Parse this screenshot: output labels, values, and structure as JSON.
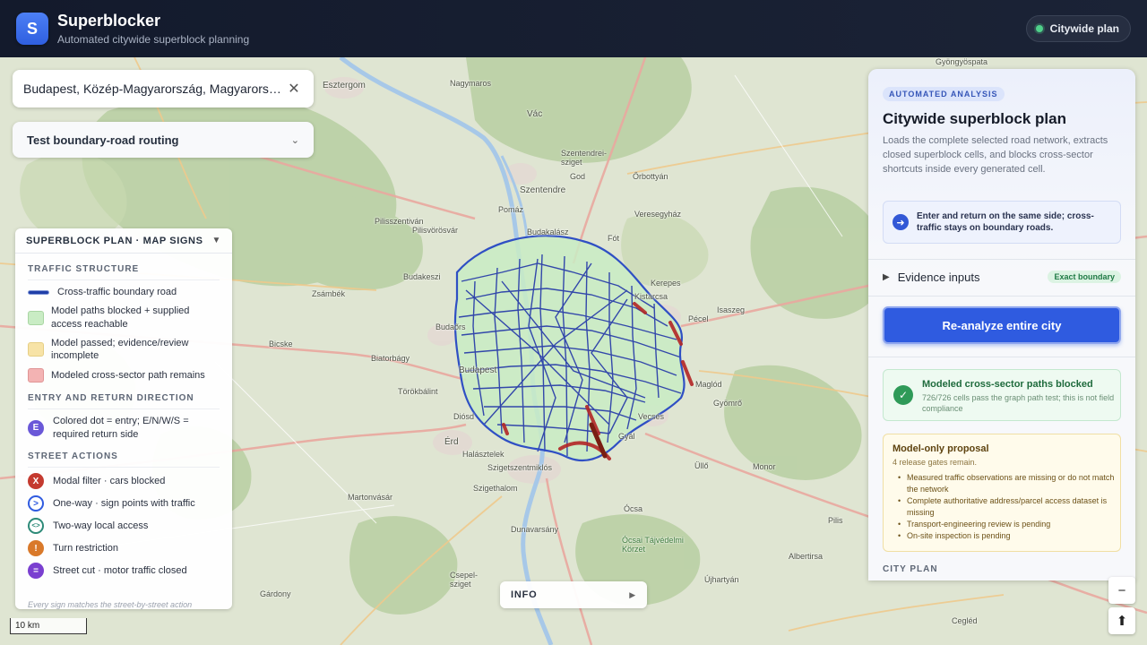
{
  "header": {
    "logo_letter": "S",
    "title": "Superblocker",
    "subtitle": "Automated citywide superblock planning",
    "plan_label": "Citywide plan"
  },
  "search": {
    "value": "Budapest, Közép-Magyarország, Magyarország",
    "clear_icon": "close-icon"
  },
  "routing": {
    "label": "Test boundary-road routing"
  },
  "legend": {
    "title": "SUPERBLOCK PLAN · MAP SIGNS",
    "sections": {
      "traffic": "TRAFFIC STRUCTURE",
      "direction": "ENTRY AND RETURN DIRECTION",
      "actions": "STREET ACTIONS"
    },
    "traffic_items": [
      {
        "label": "Cross-traffic boundary road"
      },
      {
        "label": "Model paths blocked + supplied access reachable",
        "color": "#c9ecc4"
      },
      {
        "label": "Model passed; evidence/review incomplete",
        "color": "#f7e3a6"
      },
      {
        "label": "Modeled cross-sector path remains",
        "color": "#f3b3b3"
      }
    ],
    "direction_item": {
      "glyph": "E",
      "label": "Colored dot = entry; E/N/W/S = required return side",
      "color": "#6a58d8"
    },
    "action_items": [
      {
        "glyph": "X",
        "label": "Modal filter · cars blocked",
        "color": "#c43a2f"
      },
      {
        "glyph": ">",
        "label": "One-way · sign points with traffic",
        "color": "#2f5be0"
      },
      {
        "glyph": "<>",
        "label": "Two-way local access",
        "color": "#2d8a78"
      },
      {
        "glyph": "!",
        "label": "Turn restriction",
        "color": "#d9792a"
      },
      {
        "glyph": "=",
        "label": "Street cut · motor traffic closed",
        "color": "#7a3fd0"
      }
    ],
    "footer": "Every sign matches the street-by-street action"
  },
  "info": {
    "label": "INFO"
  },
  "scale": {
    "label": "10 km"
  },
  "panel": {
    "badge": "AUTOMATED ANALYSIS",
    "title": "Citywide superblock plan",
    "description": "Loads the complete selected road network, extracts closed superblock cells, and blocks cross-sector shortcuts inside every generated cell.",
    "tip": "Enter and return on the same side; cross-traffic stays on boundary roads.",
    "evidence_label": "Evidence inputs",
    "evidence_tag": "Exact boundary",
    "reanalyze_label": "Re-analyze entire city",
    "success_title": "Modeled cross-sector paths blocked",
    "success_text": "726/726 cells pass the graph path test; this is not field compliance",
    "proposal_title": "Model-only proposal",
    "proposal_sub": "4 release gates remain.",
    "proposal_items": [
      "Measured traffic observations are missing or do not match the network",
      "Complete authoritative address/parcel access dataset is missing",
      "Transport-engineering review is pending",
      "On-site inspection is pending"
    ],
    "city_plan_label": "CITY PLAN"
  },
  "zoom": {
    "out": "−",
    "compass": "⬆"
  },
  "places": [
    {
      "name": "Gyöngyöspata",
      "big": false
    },
    {
      "name": "Esztergom",
      "big": true
    },
    {
      "name": "Nagymaros",
      "big": false
    },
    {
      "name": "Vác",
      "big": true
    },
    {
      "name": "Szentendrei-sziget",
      "big": false
    },
    {
      "name": "God",
      "big": false
    },
    {
      "name": "Őrbottyán",
      "big": false
    },
    {
      "name": "Veresegyház",
      "big": false
    },
    {
      "name": "Szentendre",
      "big": true
    },
    {
      "name": "Pilisvörösvár",
      "big": false
    },
    {
      "name": "Pilisszentiván",
      "big": false
    },
    {
      "name": "Pomáz",
      "big": false
    },
    {
      "name": "Budakeszi",
      "big": false
    },
    {
      "name": "Budakalász",
      "big": false
    },
    {
      "name": "Fót",
      "big": false
    },
    {
      "name": "Zsámbék",
      "big": false
    },
    {
      "name": "Kerepes",
      "big": false
    },
    {
      "name": "Kistarcsa",
      "big": false
    },
    {
      "name": "Isaszeg",
      "big": false
    },
    {
      "name": "Pécel",
      "big": false
    },
    {
      "name": "Bicske",
      "big": false
    },
    {
      "name": "Budaőrs",
      "big": false
    },
    {
      "name": "Biatorbágy",
      "big": false
    },
    {
      "name": "Budapest",
      "big": true
    },
    {
      "name": "Maglód",
      "big": false
    },
    {
      "name": "Gyömrő",
      "big": false
    },
    {
      "name": "Törökbálint",
      "big": false
    },
    {
      "name": "Diósd",
      "big": false
    },
    {
      "name": "Vecsés",
      "big": false
    },
    {
      "name": "Érd",
      "big": true
    },
    {
      "name": "Gyál",
      "big": false
    },
    {
      "name": "Halásztelek",
      "big": false
    },
    {
      "name": "Szigetszentmiklós",
      "big": false
    },
    {
      "name": "Üllő",
      "big": false
    },
    {
      "name": "Ócsa",
      "big": false
    },
    {
      "name": "Szigethalom",
      "big": false
    },
    {
      "name": "Martonvásár",
      "big": false
    },
    {
      "name": "Dunavarsány",
      "big": false
    },
    {
      "name": "Ócsai Tájvédelmi Körzet",
      "big": false
    },
    {
      "name": "Csepel-sziget",
      "big": false
    },
    {
      "name": "Cegléd",
      "big": false
    },
    {
      "name": "Albertirsa",
      "big": false
    },
    {
      "name": "Újhartyán",
      "big": false
    },
    {
      "name": "Gárdony",
      "big": false
    },
    {
      "name": "Monor",
      "big": false
    },
    {
      "name": "Pilis",
      "big": false
    },
    {
      "name": "Cegléd",
      "big": false
    }
  ]
}
